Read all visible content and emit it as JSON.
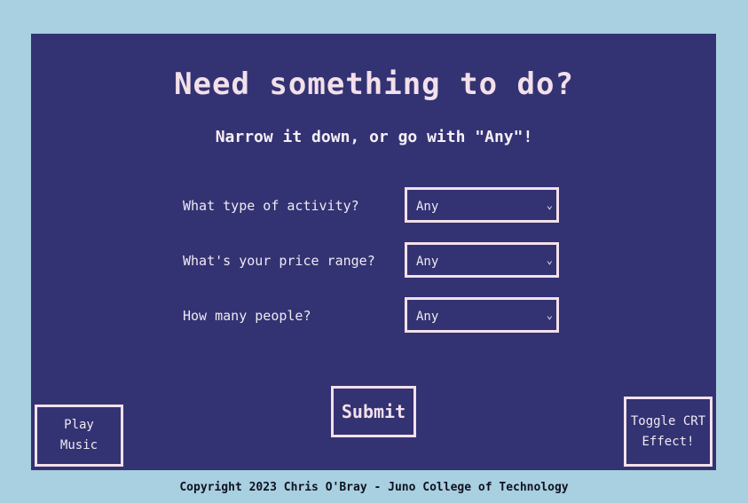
{
  "header": {
    "title": "Need something to do?",
    "subtitle": "Narrow it down, or go with \"Any\"!"
  },
  "form": {
    "questions": [
      {
        "label": "What type of activity?",
        "value": "Any"
      },
      {
        "label": "What's your price range?",
        "value": "Any"
      },
      {
        "label": "How many people?",
        "value": "Any"
      }
    ],
    "submit_label": "Submit"
  },
  "controls": {
    "play_music_line1": "Play",
    "play_music_line2": "Music",
    "crt_line1": "Toggle CRT",
    "crt_line2": "Effect!"
  },
  "footer": {
    "text": "Copyright 2023 Chris O'Bray - Juno College of Technology"
  },
  "colors": {
    "page_background": "#a8d0e0",
    "panel_background": "#333373",
    "accent_border": "#f3e0ea"
  },
  "icons": {
    "select_arrow": "chevron-down-icon"
  }
}
